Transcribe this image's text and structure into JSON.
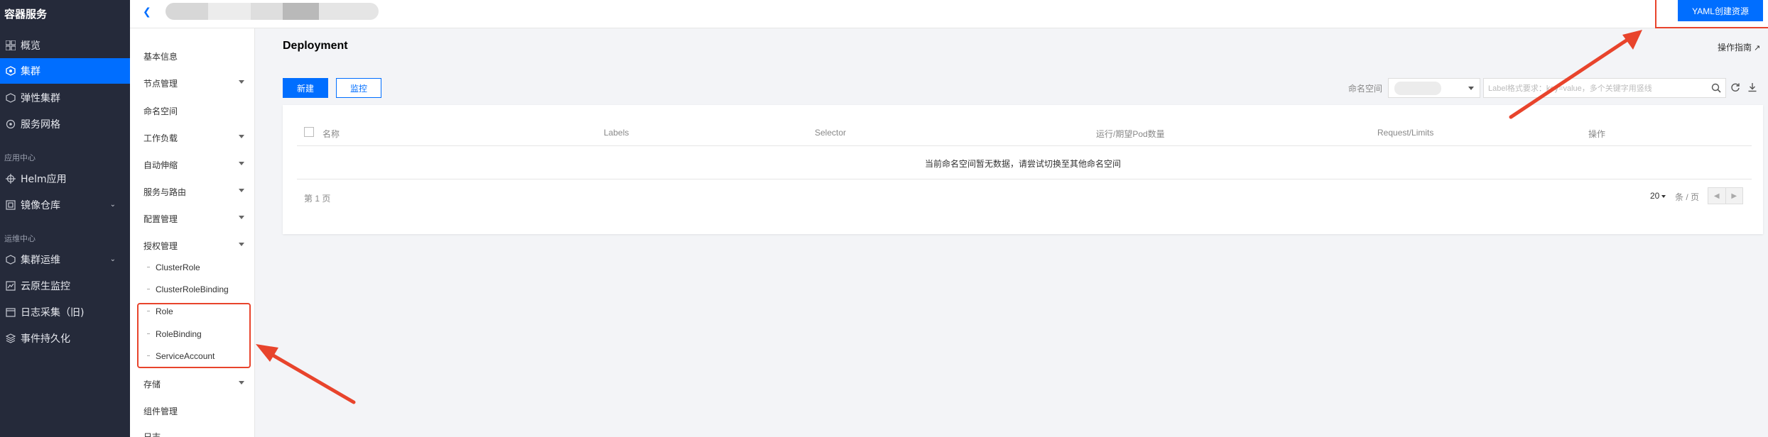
{
  "app": {
    "title": "容器服务"
  },
  "leftnav": {
    "items": [
      {
        "label": "概览",
        "icon": "grid-icon"
      },
      {
        "label": "集群",
        "icon": "cluster-icon",
        "active": true
      },
      {
        "label": "弹性集群",
        "icon": "elastic-cluster-icon"
      },
      {
        "label": "服务网格",
        "icon": "service-mesh-icon"
      }
    ],
    "section_app": "应用中心",
    "app_items": [
      {
        "label": "Helm应用",
        "icon": "helm-icon"
      },
      {
        "label": "镜像仓库",
        "icon": "image-repo-icon"
      }
    ],
    "section_ops": "运维中心",
    "ops_items": [
      {
        "label": "集群运维",
        "icon": "cluster-ops-icon"
      },
      {
        "label": "云原生监控",
        "icon": "monitor-icon"
      },
      {
        "label": "日志采集（旧)",
        "icon": "log-icon"
      },
      {
        "label": "事件持久化",
        "icon": "event-icon"
      }
    ]
  },
  "subnav": {
    "items": [
      "基本信息",
      "节点管理",
      "命名空间",
      "工作负载",
      "自动伸缩",
      "服务与路由",
      "配置管理",
      "授权管理"
    ],
    "auth_children": [
      "ClusterRole",
      "ClusterRoleBinding",
      "Role",
      "RoleBinding",
      "ServiceAccount"
    ],
    "after_items": [
      "存储",
      "组件管理",
      "日志"
    ]
  },
  "header": {
    "yaml_button": "YAML创建资源"
  },
  "main": {
    "title": "Deployment",
    "guide": "操作指南",
    "create_button": "新建",
    "monitor_button": "监控",
    "namespace_label": "命名空间",
    "search_placeholder": "Label格式要求：key=value，多个关键字用竖线"
  },
  "table": {
    "columns": [
      "名称",
      "Labels",
      "Selector",
      "运行/期望Pod数量",
      "Request/Limits",
      "操作"
    ],
    "empty_text": "当前命名空间暂无数据，请尝试切换至其他命名空间",
    "page_info": "第 1 页",
    "page_size": "20",
    "per_page_label": "条 / 页"
  },
  "colors": {
    "accent": "#006eff",
    "nav_bg": "#252a3a",
    "highlight": "#e8442c"
  }
}
